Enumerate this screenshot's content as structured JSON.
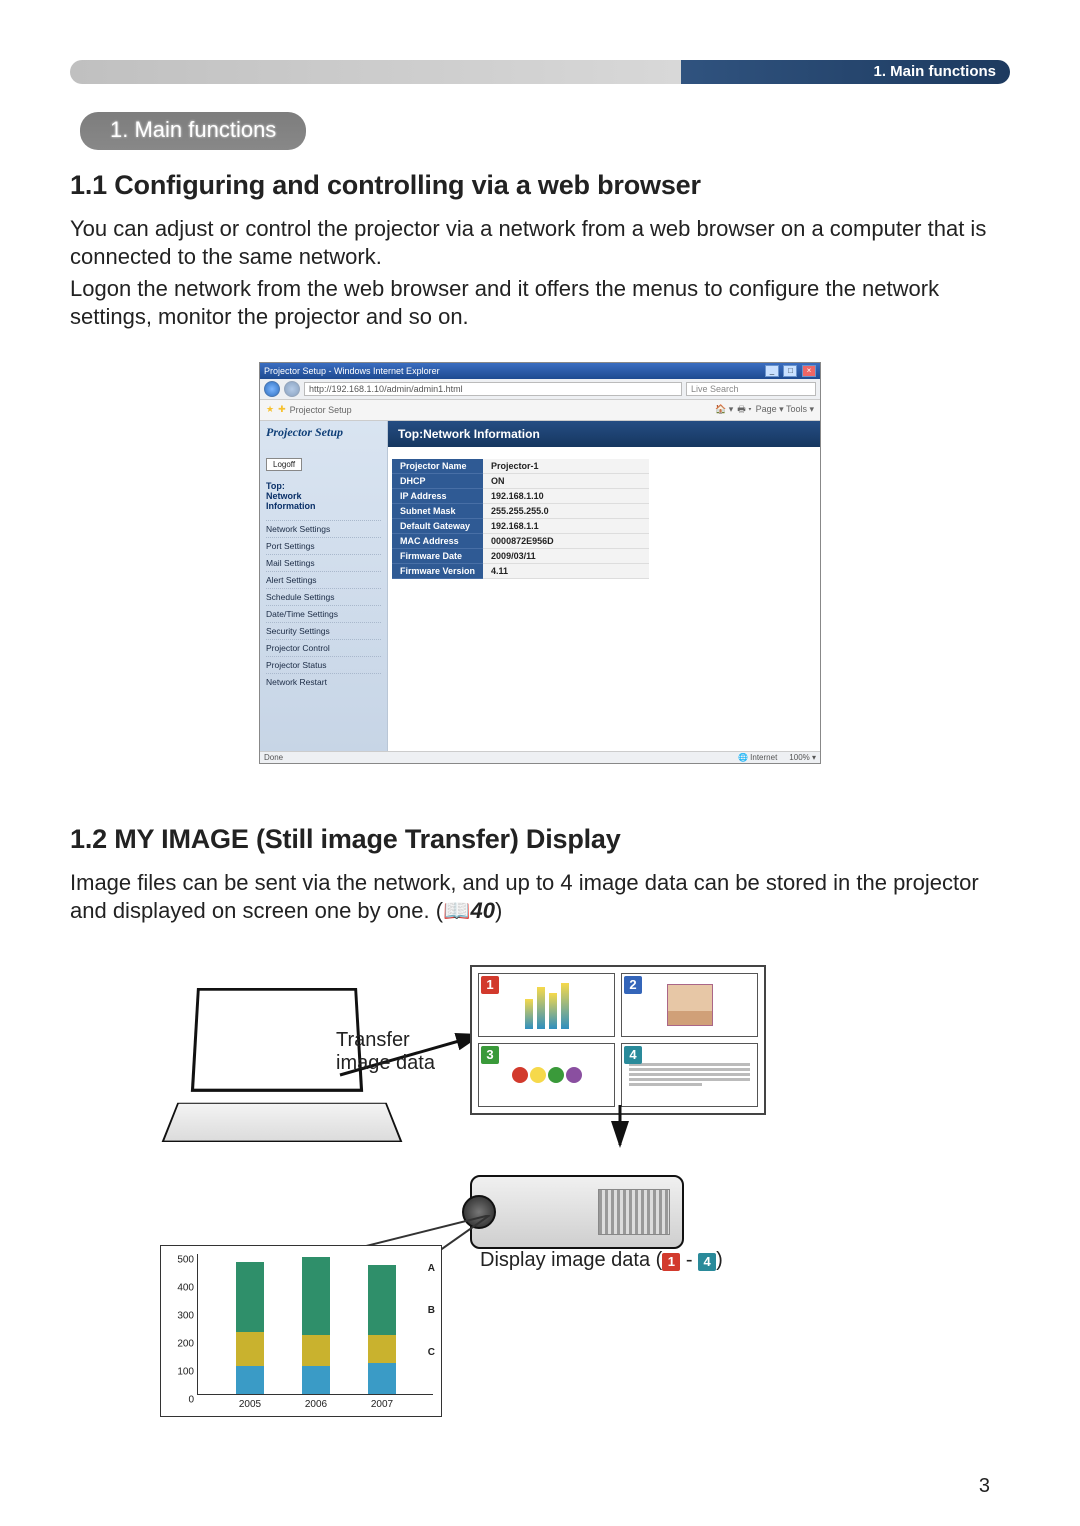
{
  "page_number": "3",
  "header": {
    "label": "1. Main functions"
  },
  "section_pill": "1. Main functions",
  "subsection_1": {
    "title": "1.1 Configuring and controlling via a web browser",
    "para_1": "You can adjust or control the projector via a network from a web browser on a computer that is connected to the same network.",
    "para_2": "Logon the network from the web browser and it offers the menus to configure the network settings, monitor the projector and so on."
  },
  "browser": {
    "titlebar": "Projector Setup - Windows Internet Explorer",
    "url": "http://192.168.1.10/admin/admin1.html",
    "search_placeholder": "Live Search",
    "fav_tab": "Projector Setup",
    "toolbar_right": "Page ▾  Tools ▾",
    "status_left": "Done",
    "status_zone": "Internet",
    "status_zoom": "100%  ▾",
    "sidebar": {
      "brand": "Projector Setup",
      "logoff": "Logoff",
      "current_top": "Top:",
      "current_mid": "Network",
      "current_bot": "Information",
      "menu": [
        "Network Settings",
        "Port Settings",
        "Mail Settings",
        "Alert Settings",
        "Schedule Settings",
        "Date/Time Settings",
        "Security Settings",
        "Projector Control",
        "Projector Status",
        "Network Restart"
      ]
    },
    "main_heading": "Top:Network Information",
    "info_rows": [
      {
        "k": "Projector Name",
        "v": "Projector-1"
      },
      {
        "k": "DHCP",
        "v": "ON"
      },
      {
        "k": "IP Address",
        "v": "192.168.1.10"
      },
      {
        "k": "Subnet Mask",
        "v": "255.255.255.0"
      },
      {
        "k": "Default Gateway",
        "v": "192.168.1.1"
      },
      {
        "k": "MAC Address",
        "v": "0000872E956D"
      },
      {
        "k": "Firmware Date",
        "v": "2009/03/11"
      },
      {
        "k": "Firmware Version",
        "v": "4.11"
      }
    ]
  },
  "subsection_2": {
    "title": "1.2 MY IMAGE (Still image Transfer) Display",
    "para_prefix": "Image files can be sent via the network, and up to 4 image data can be stored in the projector and displayed on screen one by one. (",
    "ref": "40",
    "para_suffix": ")"
  },
  "diagram": {
    "transfer_label_1": "Transfer",
    "transfer_label_2": "image data",
    "display_prefix": "Display image data (",
    "display_dash": " - ",
    "display_suffix": ")",
    "thumb_badges": [
      "1",
      "2",
      "3",
      "4"
    ]
  },
  "chart_data": {
    "type": "bar",
    "stacked": true,
    "categories": [
      "2005",
      "2006",
      "2007"
    ],
    "series": [
      {
        "name": "A",
        "values": [
          250,
          280,
          250
        ]
      },
      {
        "name": "B",
        "values": [
          120,
          110,
          100
        ]
      },
      {
        "name": "C",
        "values": [
          100,
          100,
          110
        ]
      }
    ],
    "y_ticks": [
      0,
      100,
      200,
      300,
      400,
      500
    ],
    "ylim": [
      0,
      500
    ],
    "series_label_positions": {
      "A": 120,
      "B": 78,
      "C": 36
    }
  }
}
